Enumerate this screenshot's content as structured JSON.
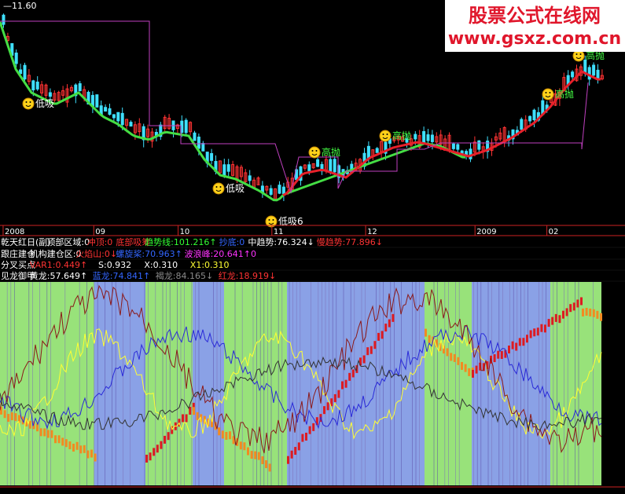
{
  "watermark": {
    "title": "股票公式在线网",
    "url": "www.gsxz.com.cn",
    "bg": "#ffffff",
    "title_color": "#e0162b",
    "url_color": "#e0162b"
  },
  "colors": {
    "bg": "#000000",
    "candle_up": "#ff3333",
    "candle_down": "#3fe0ff",
    "ma_green": "#44dd44",
    "ma_red": "#e8202a",
    "box_line": "#c040c0",
    "grid_axis": "#cc2222",
    "band_green": "#98e27a",
    "band_blue": "#8aa1e6",
    "bar_red": "#dd1b22",
    "bar_orange": "#f28a21",
    "line_yellow": "#ffff33",
    "line_blue": "#2a2ad8",
    "line_brown": "#8b1a1a",
    "line_dark": "#333333"
  },
  "main": {
    "price_label": "11.60",
    "x_ticks": [
      {
        "label": "2008",
        "pos": 0.005
      },
      {
        "label": "09",
        "pos": 0.15
      },
      {
        "label": "10",
        "pos": 0.285
      },
      {
        "label": "11",
        "pos": 0.435
      },
      {
        "label": "12",
        "pos": 0.585
      },
      {
        "label": "2009",
        "pos": 0.76
      },
      {
        "label": "02",
        "pos": 0.875
      }
    ],
    "signals": [
      {
        "label": "低吸",
        "type": "buy"
      },
      {
        "label": "低吸",
        "type": "buy"
      },
      {
        "label": "低吸6",
        "type": "buy"
      },
      {
        "label": "高抛",
        "type": "sell"
      },
      {
        "label": "高抛",
        "type": "sell"
      },
      {
        "label": "高抛",
        "type": "sell"
      },
      {
        "label": "高抛",
        "type": "sell"
      }
    ]
  },
  "indicator_rows": [
    {
      "items": [
        {
          "text": "乾天红日(副)",
          "color": "#ffffff"
        },
        {
          "text": "顶部区域:0",
          "color": "#ffffff"
        },
        {
          "text": "冲顶:0",
          "color": "#ff3333"
        },
        {
          "text": "底部吸筹",
          "color": "#ff3333"
        },
        {
          "text": "趋势线:101.216↑",
          "color": "#33ff33"
        },
        {
          "text": "抄底:0",
          "color": "#3366ff"
        },
        {
          "text": "中趋势:76.324↓",
          "color": "#ffffff"
        },
        {
          "text": "慢趋势:77.896↓",
          "color": "#ff3333"
        }
      ]
    },
    {
      "items": [
        {
          "text": "跟庄建仓",
          "color": "#ffffff"
        },
        {
          "text": "机构建仓区:0",
          "color": "#ffffff"
        },
        {
          "text": "火焰山:0↓",
          "color": "#ff3333"
        },
        {
          "text": "螺旋桨:70.963↑",
          "color": "#3366ff"
        },
        {
          "text": "波浪峰:20.641↑0",
          "color": "#ff33ff"
        }
      ]
    },
    {
      "items": [
        {
          "text": "分叉买点",
          "color": "#ffffff"
        },
        {
          "text": "VAR1:0.449↑",
          "color": "#ff3333"
        },
        {
          "text": "S:0.932",
          "color": "#ffffff"
        },
        {
          "text": "X:0.310",
          "color": "#ffffff"
        },
        {
          "text": "X1:0.310",
          "color": "#ffff33"
        }
      ]
    },
    {
      "items": [
        {
          "text": "见龙御甲",
          "color": "#ffffff"
        },
        {
          "text": "黄龙:57.649↑",
          "color": "#ffffff"
        },
        {
          "text": "蓝龙:74.841↑",
          "color": "#3366ff"
        },
        {
          "text": "褐龙:84.165↓",
          "color": "#8b8b8b"
        },
        {
          "text": "红龙:18.919↓",
          "color": "#ff3333"
        }
      ]
    }
  ],
  "chart_data": {
    "type": "line",
    "title": "",
    "xlabel": "",
    "ylabel": "",
    "x": [
      "2008",
      "09",
      "10",
      "11",
      "12",
      "2009",
      "02"
    ],
    "price_marker": 11.6,
    "series": []
  }
}
